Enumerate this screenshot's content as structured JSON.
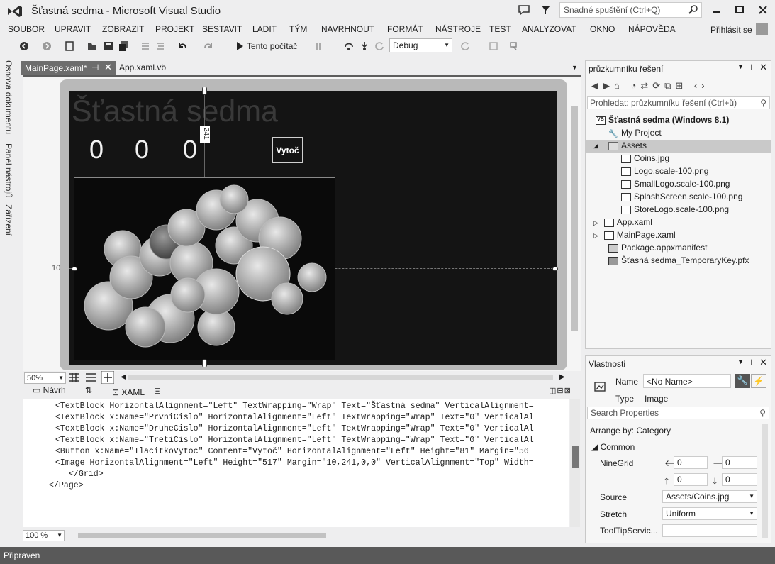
{
  "window": {
    "title": "Šťastná sedma - Microsoft Visual Studio"
  },
  "quick_launch": {
    "placeholder": "Snadné spuštění (Ctrl+Q)"
  },
  "menu": [
    "SOUBOR",
    "UPRAVIT",
    "ZOBRAZIT",
    "PROJEKT",
    "SESTAVIT",
    "LADIT",
    "TÝM",
    "NAVRHNOUT",
    "FORMÁT",
    "NÁSTROJE",
    "TEST",
    "ANALYZOVAT",
    "OKNO",
    "NÁPOVĚDA"
  ],
  "account": {
    "login": "Přihlásit se"
  },
  "toolbar": {
    "run_label": "Tento počítač",
    "config": "Debug"
  },
  "left_strip": [
    "Osnova dokumentu",
    "Panel nástrojů",
    "Zařízení"
  ],
  "doc_tabs": [
    {
      "label": "MainPage.xaml*",
      "active": true
    },
    {
      "label": "App.xaml.vb",
      "active": false
    }
  ],
  "designer": {
    "app_title": "Šťastná sedma",
    "digits": [
      "0",
      "0",
      "0"
    ],
    "spin_button": "Vytoč",
    "margin_top_label": "241",
    "margin_left_label": "10",
    "zoom": "50%"
  },
  "split": {
    "design_tab": "Návrh",
    "xaml_tab": "XAML"
  },
  "xaml_code": [
    "    <TextBlock HorizontalAlignment=\"Left\" TextWrapping=\"Wrap\" Text=\"Šťastná sedma\" VerticalAlignment=",
    "    <TextBlock x:Name=\"PrvniCislo\" HorizontalAlignment=\"Left\" TextWrapping=\"Wrap\" Text=\"0\" VerticalAl",
    "    <TextBlock x:Name=\"DruheCislo\" HorizontalAlignment=\"Left\" TextWrapping=\"Wrap\" Text=\"0\" VerticalAl",
    "    <TextBlock x:Name=\"TretiCislo\" HorizontalAlignment=\"Left\" TextWrapping=\"Wrap\" Text=\"0\" VerticalAl",
    "    <Button x:Name=\"TlacitkoVytoc\" Content=\"Vytoč\" HorizontalAlignment=\"Left\" Height=\"81\" Margin=\"56",
    "    <Image HorizontalAlignment=\"Left\" Height=\"517\" Margin=\"10,241,0,0\" VerticalAlignment=\"Top\" Width=",
    "</Grid>",
    "</Page>"
  ],
  "code_zoom": "100 %",
  "status": "Připraven",
  "solution_explorer": {
    "title": "průzkumníku řešení",
    "search_placeholder": "Prohledat: průzkumníku řešení (Ctrl+ů)",
    "items": [
      {
        "label": "Šťastná sedma (Windows 8.1)",
        "icon": "vb-project-icon",
        "bold": true
      },
      {
        "label": "My Project",
        "icon": "wrench-icon"
      },
      {
        "label": "Assets",
        "icon": "folder-icon",
        "selected": true
      },
      {
        "label": "Coins.jpg",
        "icon": "image-file-icon"
      },
      {
        "label": "Logo.scale-100.png",
        "icon": "image-file-icon"
      },
      {
        "label": "SmallLogo.scale-100.png",
        "icon": "image-file-icon"
      },
      {
        "label": "SplashScreen.scale-100.png",
        "icon": "image-file-icon"
      },
      {
        "label": "StoreLogo.scale-100.png",
        "icon": "image-file-icon"
      },
      {
        "label": "App.xaml",
        "icon": "xaml-file-icon"
      },
      {
        "label": "MainPage.xaml",
        "icon": "xaml-file-icon"
      },
      {
        "label": "Package.appxmanifest",
        "icon": "manifest-icon"
      },
      {
        "label": "Šťasná sedma_TemporaryKey.pfx",
        "icon": "certificate-icon"
      }
    ]
  },
  "properties": {
    "title": "Vlastnosti",
    "name_label": "Name",
    "name_value": "<No Name>",
    "type_label": "Type",
    "type_value": "Image",
    "search_placeholder": "Search Properties",
    "arrange": "Arrange by: Category",
    "category": "Common",
    "ninegrid_label": "NineGrid",
    "ninegrid": [
      "0",
      "0",
      "0",
      "0"
    ],
    "source_label": "Source",
    "source_value": "Assets/Coins.jpg",
    "stretch_label": "Stretch",
    "stretch_value": "Uniform",
    "tooltip_label": "ToolTipServic..."
  }
}
